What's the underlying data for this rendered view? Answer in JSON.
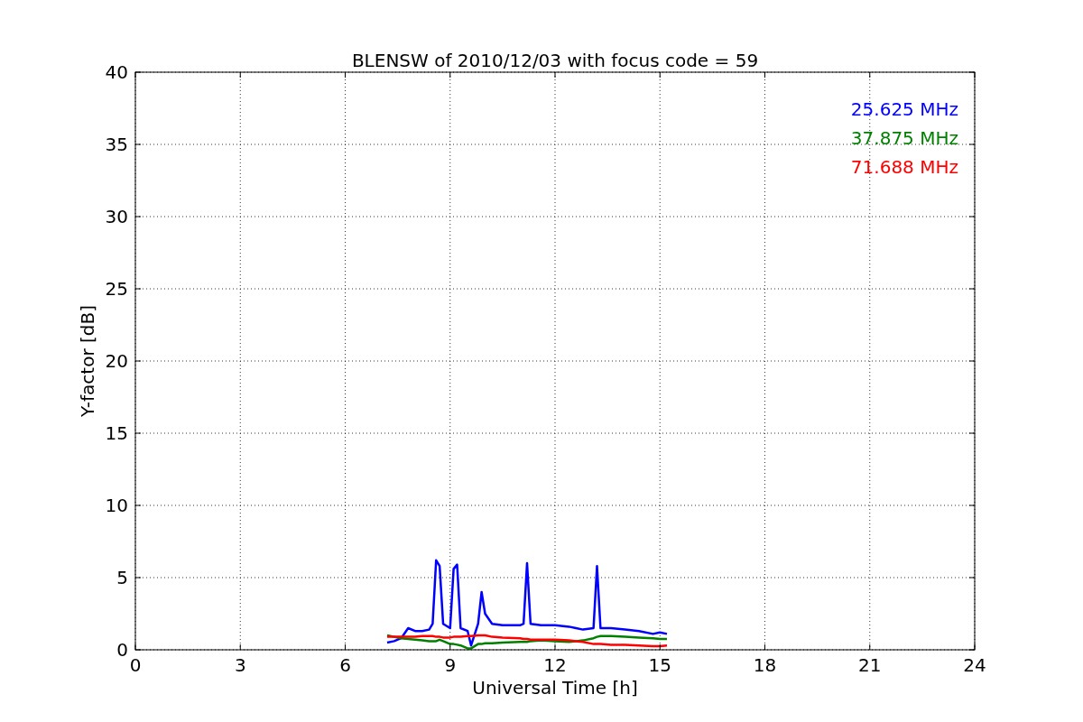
{
  "chart_data": {
    "type": "line",
    "title": "BLENSW of 2010/12/03 with focus code = 59",
    "xlabel": "Universal Time [h]",
    "ylabel": "Y-factor [dB]",
    "x": [
      7.2,
      7.4,
      7.6,
      7.8,
      8.0,
      8.2,
      8.4,
      8.5,
      8.6,
      8.7,
      8.8,
      9.0,
      9.1,
      9.2,
      9.3,
      9.5,
      9.6,
      9.8,
      9.9,
      10.0,
      10.2,
      10.5,
      11.0,
      11.1,
      11.2,
      11.3,
      11.6,
      12.0,
      12.4,
      12.6,
      12.8,
      13.1,
      13.2,
      13.3,
      13.6,
      14.0,
      14.4,
      14.8,
      15.0,
      15.2
    ],
    "series": [
      {
        "name": "25.625 MHz",
        "color": "#0000ff",
        "values": [
          0.5,
          0.6,
          0.8,
          1.5,
          1.3,
          1.3,
          1.4,
          1.8,
          6.2,
          5.8,
          1.8,
          1.5,
          5.6,
          5.9,
          1.5,
          1.3,
          0.3,
          1.8,
          4.0,
          2.5,
          1.8,
          1.7,
          1.7,
          1.8,
          6.0,
          1.8,
          1.7,
          1.7,
          1.6,
          1.5,
          1.4,
          1.5,
          5.8,
          1.5,
          1.5,
          1.4,
          1.3,
          1.1,
          1.2,
          1.1
        ]
      },
      {
        "name": "37.875 MHz",
        "color": "#008000",
        "values": [
          1.0,
          0.9,
          0.8,
          0.75,
          0.7,
          0.65,
          0.6,
          0.6,
          0.6,
          0.7,
          0.6,
          0.4,
          0.4,
          0.35,
          0.3,
          0.1,
          0.1,
          0.4,
          0.4,
          0.45,
          0.45,
          0.5,
          0.55,
          0.55,
          0.55,
          0.6,
          0.65,
          0.6,
          0.55,
          0.6,
          0.65,
          0.8,
          0.9,
          0.95,
          0.95,
          0.9,
          0.85,
          0.8,
          0.75,
          0.75
        ]
      },
      {
        "name": "71.688 MHz",
        "color": "#ff0000",
        "values": [
          0.9,
          0.9,
          0.9,
          0.9,
          0.9,
          0.95,
          0.95,
          0.95,
          0.9,
          0.9,
          0.85,
          0.85,
          0.9,
          0.9,
          0.9,
          0.95,
          0.95,
          1.0,
          1.0,
          1.0,
          0.9,
          0.85,
          0.8,
          0.75,
          0.75,
          0.7,
          0.7,
          0.7,
          0.65,
          0.6,
          0.55,
          0.4,
          0.4,
          0.4,
          0.35,
          0.35,
          0.3,
          0.25,
          0.25,
          0.3
        ]
      }
    ],
    "xlim": [
      0,
      24
    ],
    "ylim": [
      0,
      40
    ],
    "xticks": [
      0,
      3,
      6,
      9,
      12,
      15,
      18,
      21,
      24
    ],
    "yticks": [
      0,
      5,
      10,
      15,
      20,
      25,
      30,
      35,
      40
    ],
    "grid": true
  }
}
